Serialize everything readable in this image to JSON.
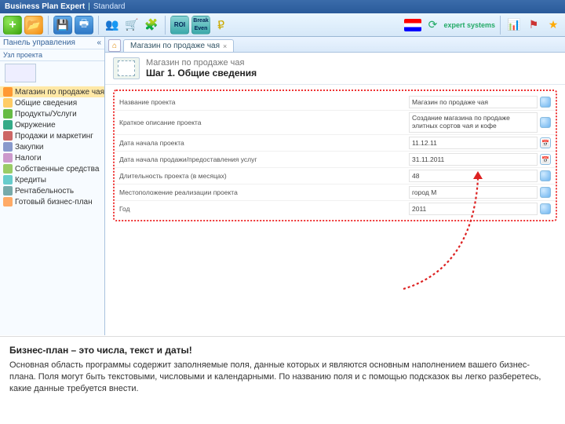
{
  "title_bar": {
    "app": "Business Plan Expert",
    "mode": "Standard"
  },
  "ribbon": {
    "right_logo": "expert systems"
  },
  "sidebar": {
    "header": "Панель управления",
    "section": "Узл проекта",
    "items": [
      {
        "label": "Магазин по продаже чая",
        "sel": true,
        "icon": "ic2"
      },
      {
        "label": "Общие сведения",
        "icon": "ic3"
      },
      {
        "label": "Продукты/Услуги",
        "icon": "ic4"
      },
      {
        "label": "Окружение",
        "icon": "ic5"
      },
      {
        "label": "Продажи и маркетинг",
        "icon": "ic6"
      },
      {
        "label": "Закупки",
        "icon": "ic7"
      },
      {
        "label": "Налоги",
        "icon": "ic8"
      },
      {
        "label": "Собственные средства",
        "icon": "ic9"
      },
      {
        "label": "Кредиты",
        "icon": "ic10"
      },
      {
        "label": "Рентабельность",
        "icon": "ic1"
      },
      {
        "label": "Готовый бизнес-план",
        "icon": "ic11"
      }
    ]
  },
  "tab": {
    "label": "Магазин по продаже чая"
  },
  "header": {
    "subtitle": "Магазин по продаже чая",
    "title": "Шаг 1. Общие сведения"
  },
  "form": [
    {
      "label": "Название проекта",
      "value": "Магазин по продаже чая",
      "btn": "note",
      "tall": false
    },
    {
      "label": "Краткое описание проекта",
      "value": "Создание магазина по продаже элитных сортов чая и кофе",
      "btn": "note",
      "tall": true
    },
    {
      "label": "Дата начала проекта",
      "value": "11.12.11",
      "btn": "cal",
      "tall": false
    },
    {
      "label": "Дата начала продажи/предоставления услуг",
      "value": "31.11.2011",
      "btn": "cal",
      "tall": false
    },
    {
      "label": "Длительность проекта (в месяцах)",
      "value": "48",
      "btn": "note",
      "tall": false
    },
    {
      "label": "Местоположение реализации проекта",
      "value": "город М",
      "btn": "note",
      "tall": false
    },
    {
      "label": "Год",
      "value": "2011",
      "btn": "note",
      "tall": false
    }
  ],
  "caption": {
    "heading": "Бизнес-план – это числа, текст и даты!",
    "body": "Основная область программы содержит заполняемые поля, данные которых и являются основным наполнением вашего бизнес-плана. Поля могут быть текстовыми, числовыми и календарными. По названию поля и с помощью подсказок вы легко разберетесь, какие данные требуется внести."
  }
}
